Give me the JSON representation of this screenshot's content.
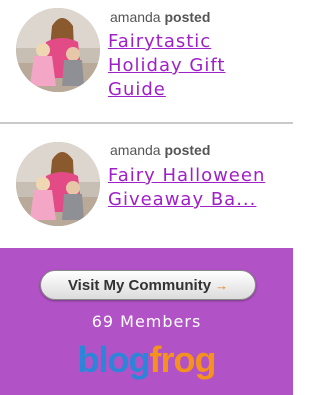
{
  "posts": [
    {
      "author": "amanda",
      "verb": "posted",
      "title": "Fairytastic Holiday Gift Guide"
    },
    {
      "author": "amanda",
      "verb": "posted",
      "title": "Fairy Halloween Giveaway Ba..."
    }
  ],
  "community": {
    "button_label": "Visit My Community",
    "button_arrow": "→",
    "members": "69 Members",
    "logo_part1": "blog",
    "logo_part2": "frog"
  },
  "colors": {
    "link": "#a020c8",
    "panel": "#b153c6",
    "logo_blue": "#2b86d9",
    "logo_orange": "#f5921e"
  }
}
